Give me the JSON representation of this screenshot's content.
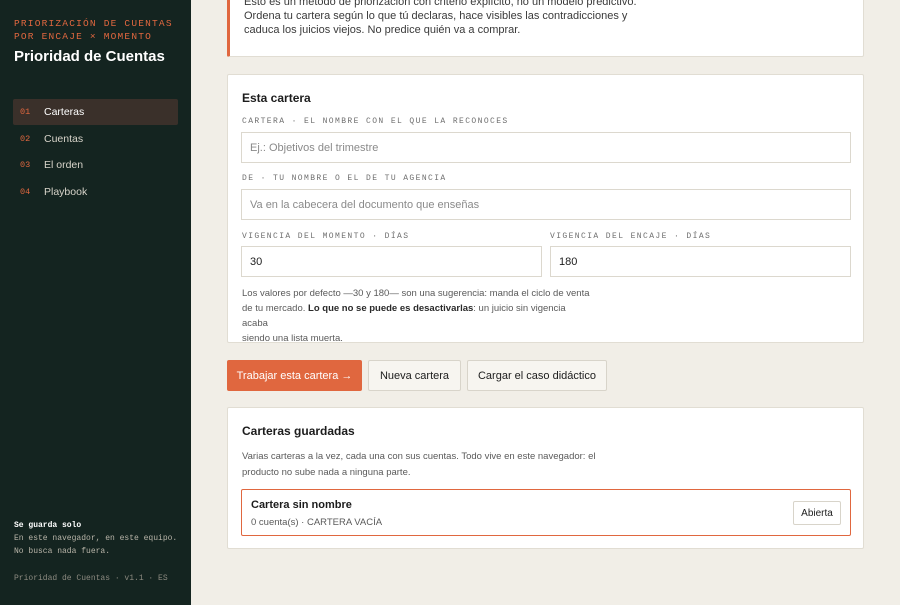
{
  "sidebar": {
    "kicker": "PRIORIZACIÓN DE CUENTAS POR ENCAJE × MOMENTO",
    "title": "Prioridad de Cuentas",
    "nav": [
      {
        "num": "01",
        "label": "Carteras",
        "active": true
      },
      {
        "num": "02",
        "label": "Cuentas",
        "active": false
      },
      {
        "num": "03",
        "label": "El orden",
        "active": false
      },
      {
        "num": "04",
        "label": "Playbook",
        "active": false
      }
    ],
    "note_title": "Se guarda solo",
    "note_line1": "En este navegador, en este equipo.",
    "note_line2": "No busca nada fuera.",
    "version": "Prioridad de Cuentas · v1.1 · ES"
  },
  "intro": {
    "line1": "Esto es un método de priorización con criterio explícito, no un modelo predictivo.",
    "line2": "Ordena tu cartera según lo que tú declaras, hace visibles las contradicciones y",
    "line3": "caduca los juicios viejos. No predice quién va a comprar."
  },
  "form": {
    "title": "Esta cartera",
    "name_label": "CARTERA · EL NOMBRE CON EL QUE LA RECONOCES",
    "name_placeholder": "Ej.: Objetivos del trimestre",
    "author_label": "DE · TU NOMBRE O EL DE TU AGENCIA",
    "author_placeholder": "Va en la cabecera del documento que enseñas",
    "moment_label": "VIGENCIA DEL MOMENTO · DÍAS",
    "moment_value": "30",
    "fit_label": "VIGENCIA DEL ENCAJE · DÍAS",
    "fit_value": "180",
    "help_line1": "Los valores por defecto —30 y 180— son una sugerencia: manda el ciclo de venta",
    "help_line2a": "de tu mercado. ",
    "help_line2b": "Lo que no se puede es desactivarlas",
    "help_line2c": ": un juicio sin vigencia acaba",
    "help_line3": "siendo una lista muerta."
  },
  "actions": {
    "primary": "Trabajar esta cartera →",
    "new": "Nueva cartera",
    "demo": "Cargar el caso didáctico"
  },
  "saved": {
    "title": "Carteras guardadas",
    "desc_line1": "Varias carteras a la vez, cada una con sus cuentas. Todo vive en este navegador: el",
    "desc_line2": "producto no sube nada a ninguna parte.",
    "items": [
      {
        "name": "Cartera sin nombre",
        "meta": "0 cuenta(s) · CARTERA VACÍA",
        "badge": "Abierta"
      }
    ]
  },
  "colors": {
    "accent": "#e0673f",
    "sidebar_bg": "#142420",
    "page_bg": "#f1eee7"
  }
}
